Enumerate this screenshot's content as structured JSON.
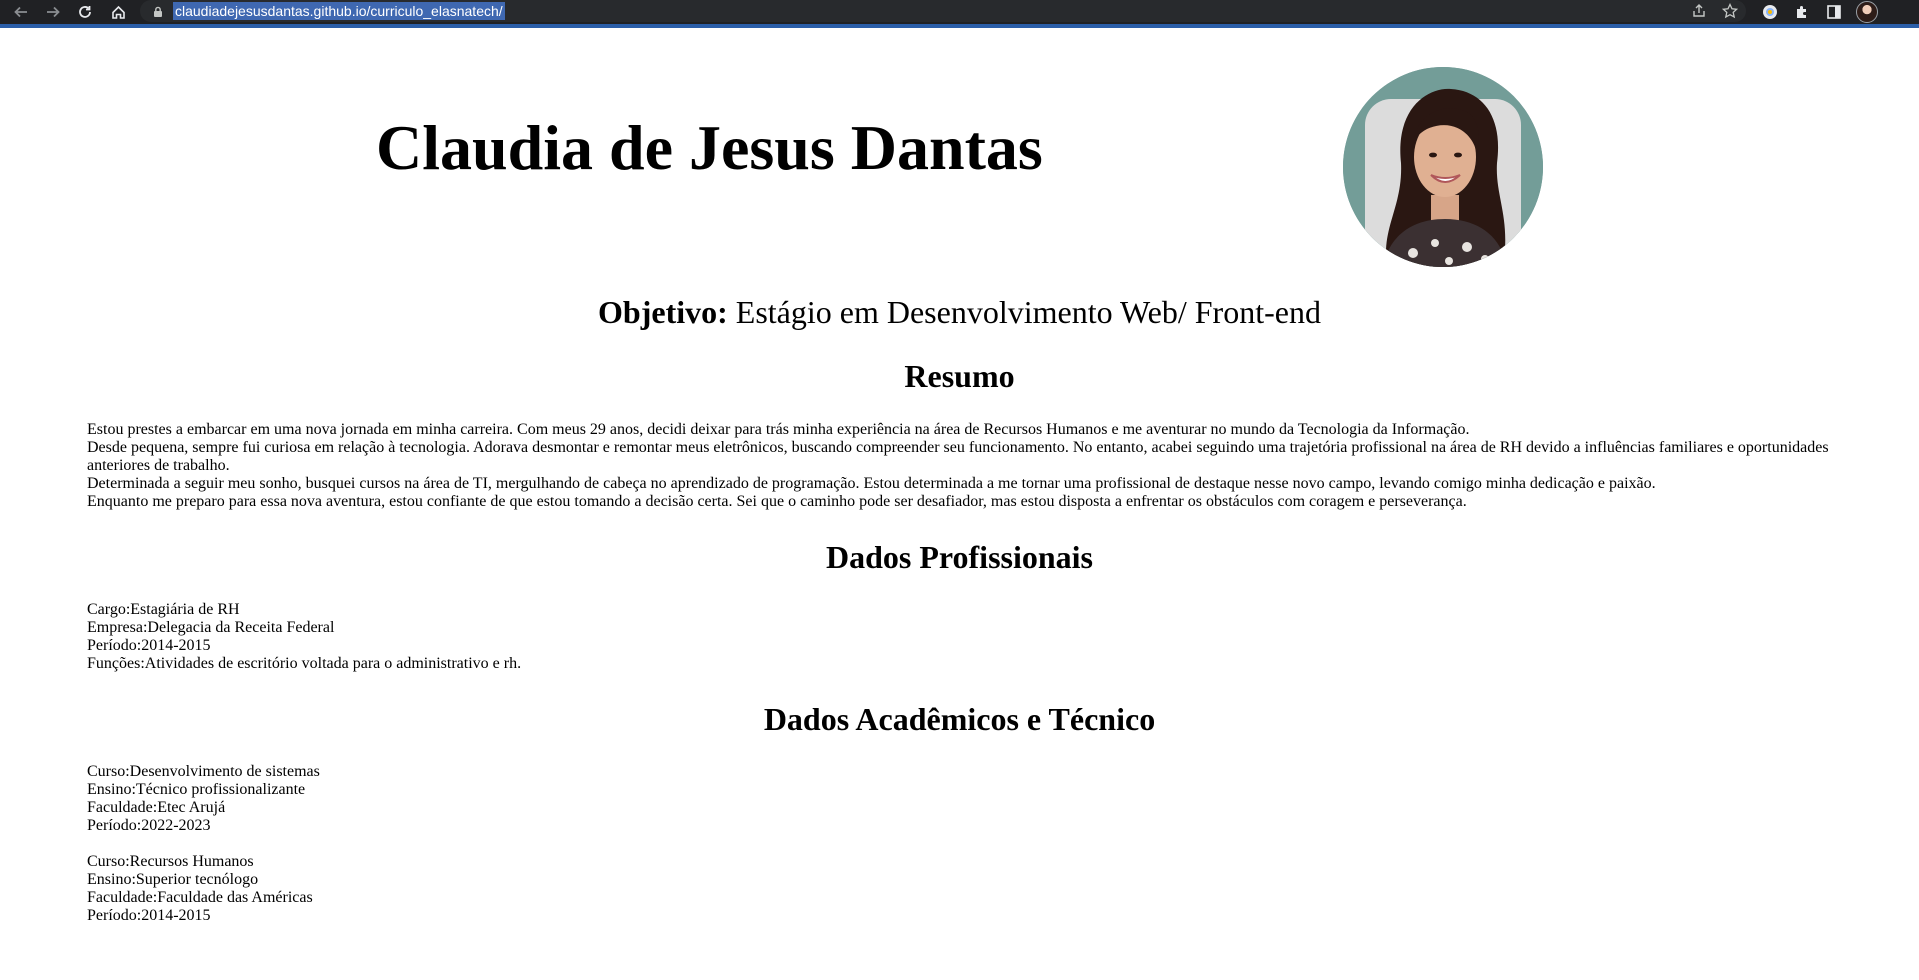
{
  "browser": {
    "url": "claudiadejesusdantas.github.io/curriculo_elasnatech/",
    "accent_color": "#2b5ea8",
    "icons": [
      "back-arrow-icon",
      "forward-arrow-icon",
      "reload-icon",
      "home-icon",
      "lock-icon",
      "share-icon",
      "star-icon",
      "extension-circle-icon",
      "puzzle-icon",
      "side-panel-icon",
      "profile-avatar"
    ]
  },
  "header": {
    "name": "Claudia de Jesus Dantas",
    "photo_bg_color": "#739d98"
  },
  "objective": {
    "label": "Objetivo:",
    "text": " Estágio em Desenvolvimento Web/ Front-end"
  },
  "summary": {
    "heading": "Resumo",
    "paragraphs": [
      "Estou prestes a embarcar em uma nova jornada em minha carreira. Com meus 29 anos, decidi deixar para trás minha experiência na área de Recursos Humanos e me aventurar no mundo da Tecnologia da Informação.",
      "Desde pequena, sempre fui curiosa em relação à tecnologia. Adorava desmontar e remontar meus eletrônicos, buscando compreender seu funcionamento. No entanto, acabei seguindo uma trajetória profissional na área de RH devido a influências familiares e oportunidades anteriores de trabalho.",
      "Determinada a seguir meu sonho, busquei cursos na área de TI, mergulhando de cabeça no aprendizado de programação. Estou determinada a me tornar uma profissional de destaque nesse novo campo, levando comigo minha dedicação e paixão.",
      "Enquanto me preparo para essa nova aventura, estou confiante de que estou tomando a decisão certa. Sei que o caminho pode ser desafiador, mas estou disposta a enfrentar os obstáculos com coragem e perseverança."
    ]
  },
  "professional": {
    "heading": "Dados Profissionais",
    "lines": [
      "Cargo:Estagiária de RH",
      "Empresa:Delegacia da Receita Federal",
      "Período:2014-2015",
      "Funções:Atividades de escritório voltada para o administrativo e rh."
    ]
  },
  "academic": {
    "heading": "Dados Acadêmicos e Técnico",
    "course1": [
      "Curso:Desenvolvimento de sistemas",
      "Ensino:Técnico profissionalizante",
      "Faculdade:Etec Arujá",
      "Período:2022-2023"
    ],
    "course2": [
      "Curso:Recursos Humanos",
      "Ensino:Superior tecnólogo",
      "Faculdade:Faculdade das Américas",
      "Período:2014-2015"
    ]
  }
}
